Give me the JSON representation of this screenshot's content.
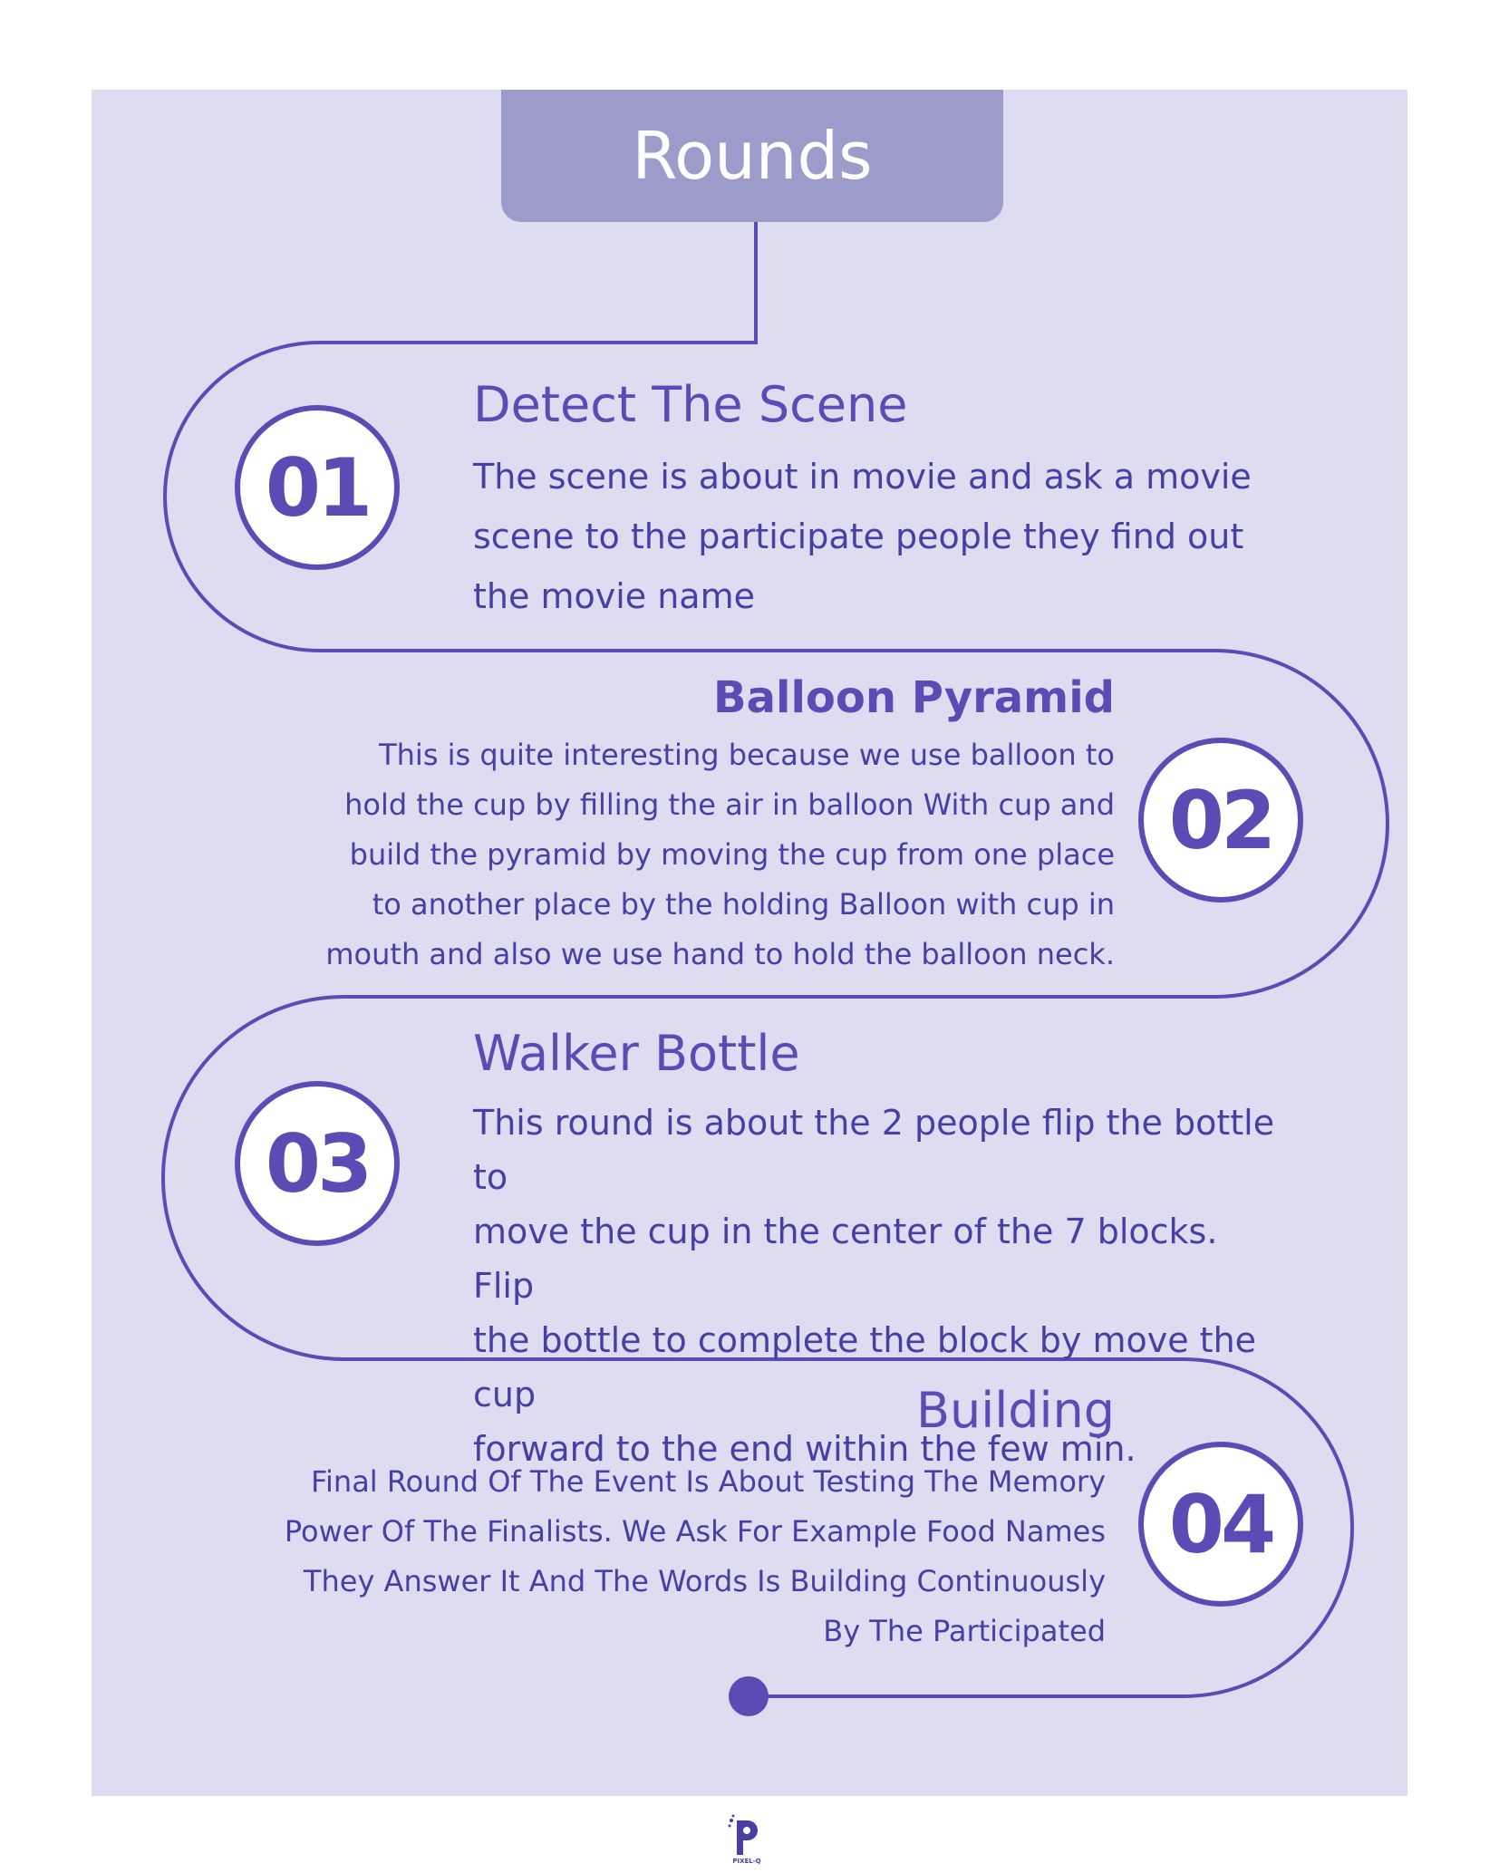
{
  "title": "Rounds",
  "rounds": [
    {
      "number": "01",
      "heading": "Detect The Scene",
      "lines": [
        "The scene is about in movie and ask a movie",
        "scene to the participate people they find out",
        "the movie name"
      ]
    },
    {
      "number": "02",
      "heading": "Balloon Pyramid",
      "lines": [
        "This is quite interesting because we use balloon to",
        "hold the cup by filling the air in balloon With cup and",
        "build the pyramid by moving the cup from one place",
        "to another place by the holding Balloon with cup in",
        "mouth and also we use hand to hold the balloon neck."
      ]
    },
    {
      "number": "03",
      "heading": "Walker Bottle",
      "lines": [
        "This round is about the 2 people flip the bottle to",
        "move the cup in the center of the 7 blocks. Flip",
        "the bottle to complete the block by move the cup",
        "forward to the end within the few min."
      ]
    },
    {
      "number": "04",
      "heading": "Building",
      "lines": [
        "Final Round Of The Event Is About Testing The Memory",
        "Power Of The Finalists. We Ask For Example Food Names",
        "They Answer It And The Words Is Building Continuously",
        "By The Participated"
      ]
    }
  ],
  "logo": {
    "text": "PIXEL-Q"
  },
  "colors": {
    "background": "#dddcf0",
    "title_tab": "#9c9ccb",
    "accent": "#5a4bb5"
  }
}
